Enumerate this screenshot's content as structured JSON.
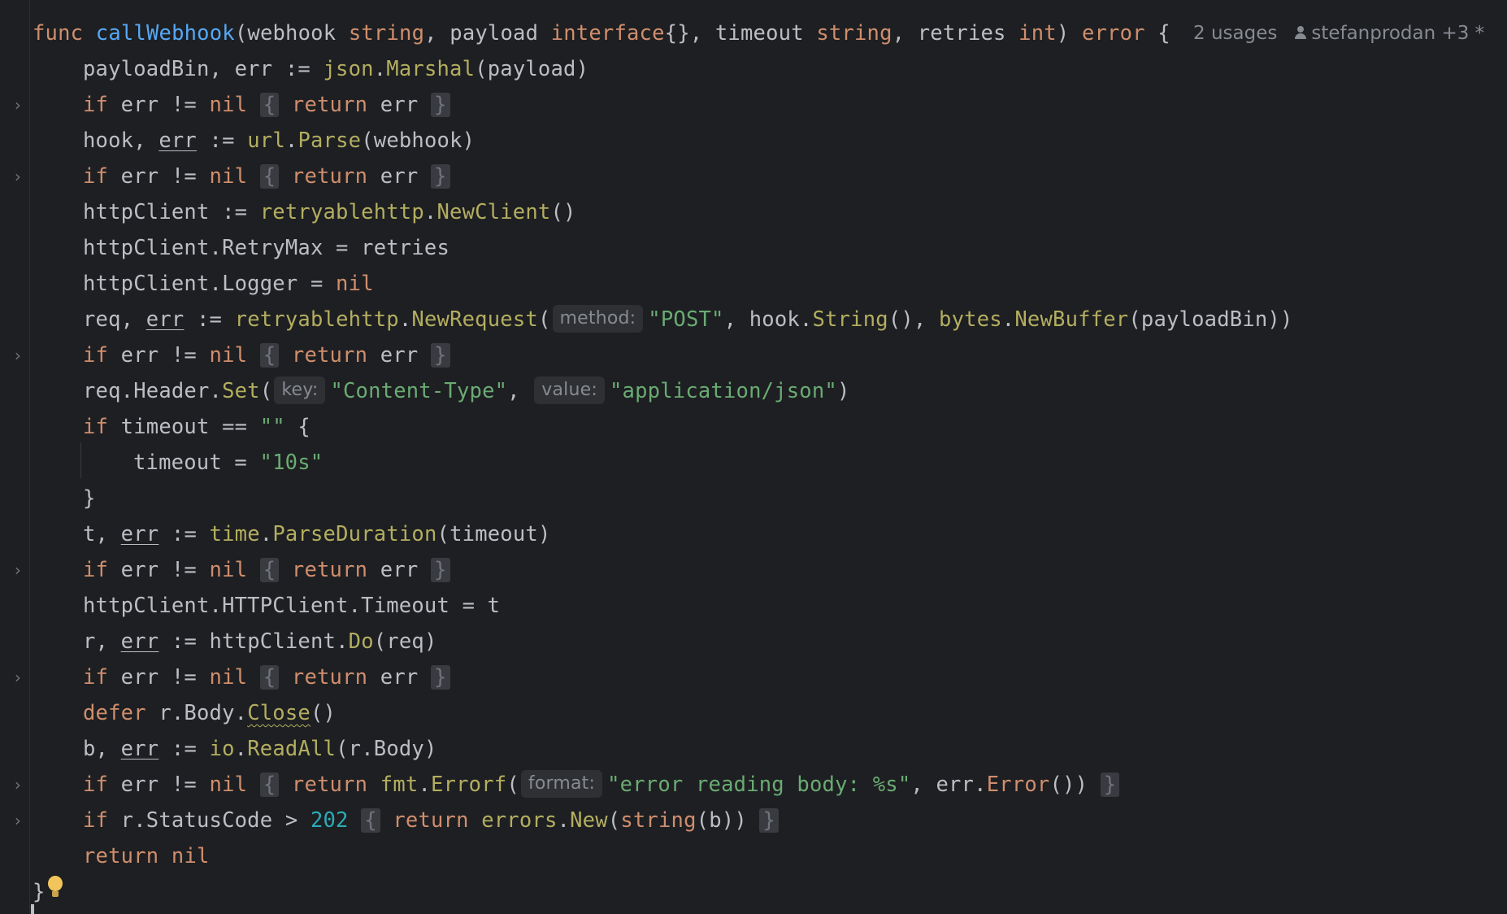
{
  "editor": {
    "colors": {
      "background": "#1e1f22",
      "keyword": "#cf8e6d",
      "function_decl": "#56a8f5",
      "function_call": "#b3ae60",
      "string": "#6aab73",
      "number": "#2aacb8",
      "text": "#bcbec4",
      "hint": "#868a91"
    },
    "inlay": {
      "usages": "2 usages",
      "author": "stefanprodan +3 *"
    },
    "icons": {
      "fold": "chevron-right-icon",
      "intention": "lightbulb-icon",
      "author": "person-icon"
    },
    "lines": {
      "l1": {
        "kw_func": "func ",
        "name": "callWebhook",
        "p1": "(webhook ",
        "t1": "string",
        "p2": ", payload ",
        "t2": "interface",
        "p3": "{}, timeout ",
        "t3": "string",
        "p4": ", retries ",
        "t4": "int",
        "p5": ") ",
        "t5": "error",
        "p6": " {"
      },
      "l2": {
        "a": "payloadBin, err := ",
        "pkg": "json",
        "dot": ".",
        "fn": "Marshal",
        "b": "(payload)"
      },
      "l3": {
        "kw_if": "if",
        "a": " err != ",
        "nil": "nil",
        "sp": " ",
        "ob": "{",
        "sp2": " ",
        "ret": "return",
        "b": " err ",
        "cb": "}"
      },
      "l4": {
        "a": "hook, ",
        "err": "err",
        "b": " := ",
        "pkg": "url",
        "dot": ".",
        "fn": "Parse",
        "c": "(webhook)"
      },
      "l5": {
        "kw_if": "if",
        "a": " err != ",
        "nil": "nil",
        "sp": " ",
        "ob": "{",
        "sp2": " ",
        "ret": "return",
        "b": " err ",
        "cb": "}"
      },
      "l6": {
        "a": "httpClient := ",
        "pkg": "retryablehttp",
        "dot": ".",
        "fn": "NewClient",
        "b": "()"
      },
      "l7": {
        "a": "httpClient.RetryMax = retries"
      },
      "l8": {
        "a": "httpClient.Logger = ",
        "nil": "nil"
      },
      "l9": {
        "a": "req, ",
        "err": "err",
        "b": " := ",
        "pkg": "retryablehttp",
        "dot": ".",
        "fn": "NewRequest",
        "c": "(",
        "hint": "method:",
        "s1": "\"POST\"",
        "d": ", hook.",
        "fn2": "String",
        "e": "(), ",
        "pkg2": "bytes",
        "dot2": ".",
        "fn3": "NewBuffer",
        "f": "(payloadBin))"
      },
      "l10": {
        "kw_if": "if",
        "a": " err != ",
        "nil": "nil",
        "sp": " ",
        "ob": "{",
        "sp2": " ",
        "ret": "return",
        "b": " err ",
        "cb": "}"
      },
      "l11": {
        "a": "req.Header.",
        "fn": "Set",
        "b": "(",
        "hint1": "key:",
        "s1": "\"Content-Type\"",
        "c": ", ",
        "hint2": "value:",
        "s2": "\"application/json\"",
        "d": ")"
      },
      "l12": {
        "kw_if": "if",
        "a": " timeout == ",
        "s": "\"\"",
        "b": " {"
      },
      "l13": {
        "a": "timeout = ",
        "s": "\"10s\""
      },
      "l14": {
        "a": "}"
      },
      "l15": {
        "a": "t, ",
        "err": "err",
        "b": " := ",
        "pkg": "time",
        "dot": ".",
        "fn": "ParseDuration",
        "c": "(timeout)"
      },
      "l16": {
        "kw_if": "if",
        "a": " err != ",
        "nil": "nil",
        "sp": " ",
        "ob": "{",
        "sp2": " ",
        "ret": "return",
        "b": " err ",
        "cb": "}"
      },
      "l17": {
        "a": "httpClient.HTTPClient.Timeout = t"
      },
      "l18": {
        "a": "r, ",
        "err": "err",
        "b": " := httpClient.",
        "fn": "Do",
        "c": "(req)"
      },
      "l19": {
        "kw_if": "if",
        "a": " err != ",
        "nil": "nil",
        "sp": " ",
        "ob": "{",
        "sp2": " ",
        "ret": "return",
        "b": " err ",
        "cb": "}"
      },
      "l20": {
        "kw": "defer",
        "a": " r.Body.",
        "fn": "Close",
        "b": "()"
      },
      "l21": {
        "a": "b, ",
        "err": "err",
        "b": " := ",
        "pkg": "io",
        "dot": ".",
        "fn": "ReadAll",
        "c": "(r.Body)"
      },
      "l22": {
        "kw_if": "if",
        "a": " err != ",
        "nil": "nil",
        "sp": " ",
        "ob": "{",
        "sp2": " ",
        "ret": "return",
        "b": " ",
        "pkg": "fmt",
        "dot": ".",
        "fn": "Errorf",
        "c": "(",
        "hint": "format:",
        "s": "\"error reading body: %s\"",
        "d": ", err.",
        "fn2": "Error",
        "e": "()) ",
        "cb": "}"
      },
      "l23": {
        "kw_if": "if",
        "a": " r.StatusCode > ",
        "num": "202",
        "sp": " ",
        "ob": "{",
        "sp2": " ",
        "ret": "return",
        "b": " ",
        "pkg": "errors",
        "dot": ".",
        "fn": "New",
        "c": "(",
        "t": "string",
        "d": "(b)) ",
        "cb": "}"
      },
      "l24": {
        "ret": "return",
        "sp": " ",
        "nil": "nil"
      },
      "l25": {
        "a": "}"
      }
    }
  }
}
